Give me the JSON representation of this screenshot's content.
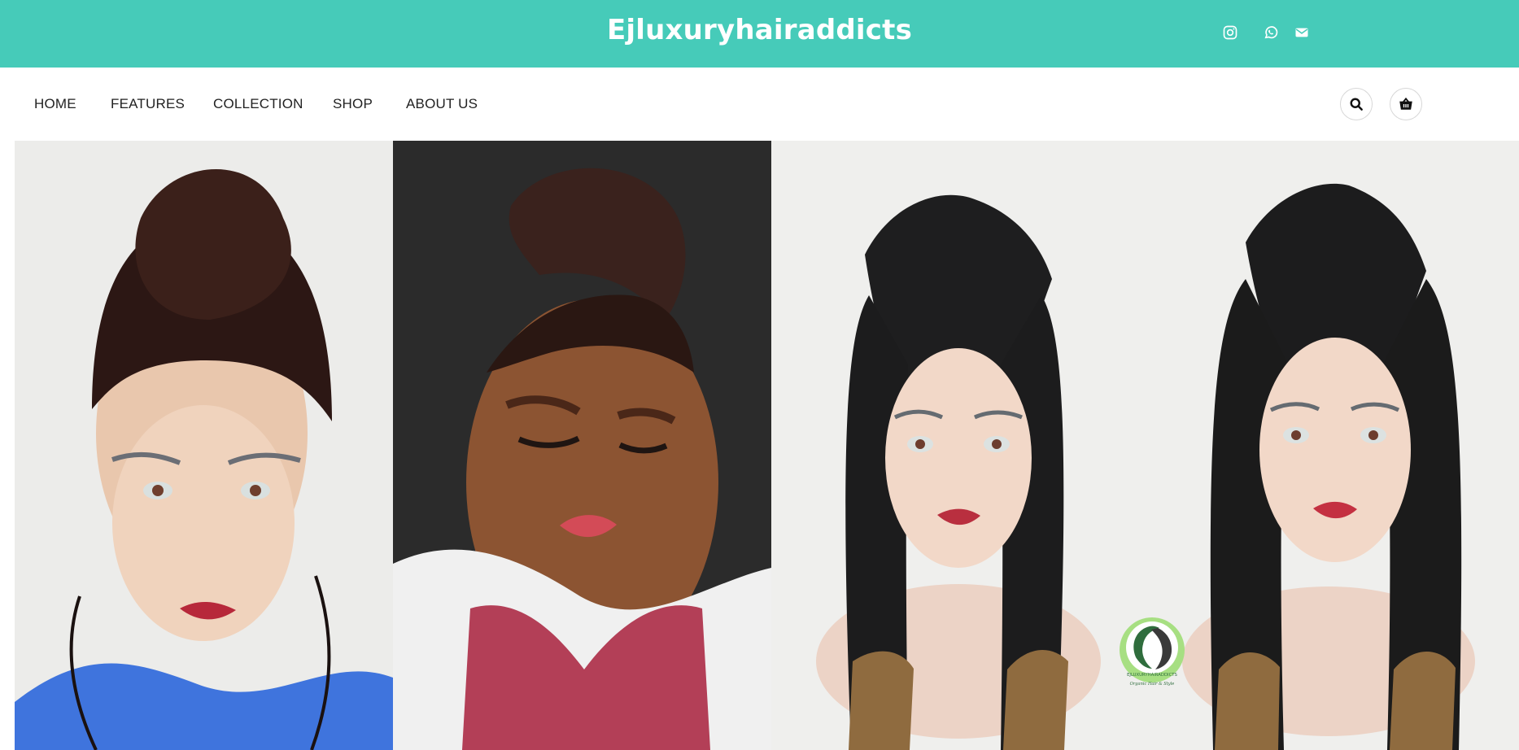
{
  "header": {
    "brand": "Ejluxuryhairaddicts",
    "background": "#46cbb9",
    "social_icons": [
      "instagram-icon",
      "whatsapp-icon",
      "envelope-icon"
    ]
  },
  "nav": {
    "items": [
      {
        "label": "HOME"
      },
      {
        "label": "FEATURES"
      },
      {
        "label": "COLLECTION"
      },
      {
        "label": "SHOP"
      },
      {
        "label": "ABOUT US"
      }
    ],
    "actions": [
      "search-icon",
      "shopping-basket-icon"
    ]
  },
  "gallery": {
    "images": [
      {
        "alt": "Mannequin wearing braided updo wig"
      },
      {
        "alt": "Woman wearing braided updo hairstyle"
      },
      {
        "alt": "Mannequin wearing braided pigtail wig"
      },
      {
        "alt": "Mannequin wearing long box braid wig"
      }
    ],
    "watermark": {
      "text_top": "EJLUXURYHAIRADDICTS",
      "text_bottom": "Organic Hair & Style"
    }
  }
}
